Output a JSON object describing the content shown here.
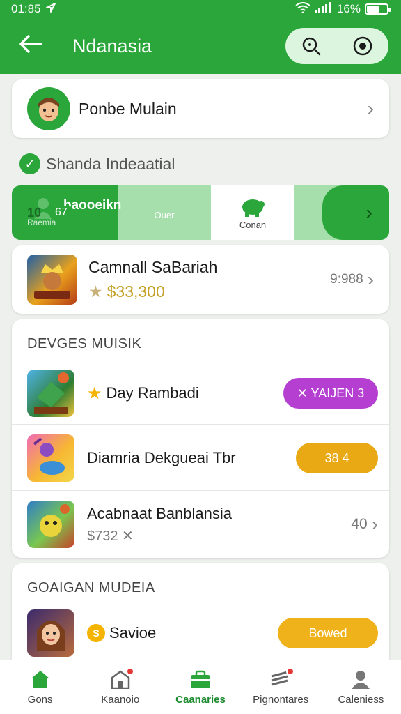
{
  "status_bar": {
    "time": "01:85",
    "battery": "16%",
    "battery_level": 0.6
  },
  "app_bar": {
    "title": "Ndanasia",
    "back_icon": "arrow-left-icon",
    "search_icon": "search-icon",
    "record_icon": "record-icon"
  },
  "profile": {
    "name": "Ponbe Mulain",
    "avatar_icon": "person-avatar-icon"
  },
  "section": {
    "label": "Shanda Indeaatial"
  },
  "banner": {
    "segment1": {
      "title": "baooeikn",
      "subtitle": "Raemia"
    },
    "segment2": {
      "value_a": "10",
      "value_b": "67",
      "subtitle": "Ouer"
    },
    "segment3": {
      "subtitle": "Conan"
    }
  },
  "featured": {
    "name": "Camnall SaBariah",
    "price": "$33,300",
    "meta": "9:988"
  },
  "list": {
    "heading": "DEVGES MUISIK",
    "items": [
      {
        "name": "Day Rambadi",
        "button": "✕ YAIJEN 3",
        "button_color": "#b43fd1"
      },
      {
        "name": "Diamria Dekgueai Tbr",
        "button": "38 4",
        "button_color": "#e9a915"
      },
      {
        "name": "Acabnaat Banblansia",
        "sub": "$732 ✕",
        "meta": "40"
      }
    ]
  },
  "promo": {
    "heading": "GOAIGAN MUDEIA",
    "item": {
      "name": "Savioe",
      "button": "Bowed",
      "button_color": "#f0b21a"
    }
  },
  "bottom_nav": [
    {
      "label": "Gons",
      "icon": "home-icon",
      "active": false
    },
    {
      "label": "Kaanoio",
      "icon": "store-icon",
      "active": false
    },
    {
      "label": "Caanaries",
      "icon": "briefcase-icon",
      "active": true
    },
    {
      "label": "Pignontares",
      "icon": "stack-icon",
      "active": false
    },
    {
      "label": "Caleniess",
      "icon": "user-icon",
      "active": false
    }
  ],
  "colors": {
    "brand": "#2aa63a",
    "accent_purple": "#b43fd1",
    "accent_gold": "#e9a915"
  }
}
